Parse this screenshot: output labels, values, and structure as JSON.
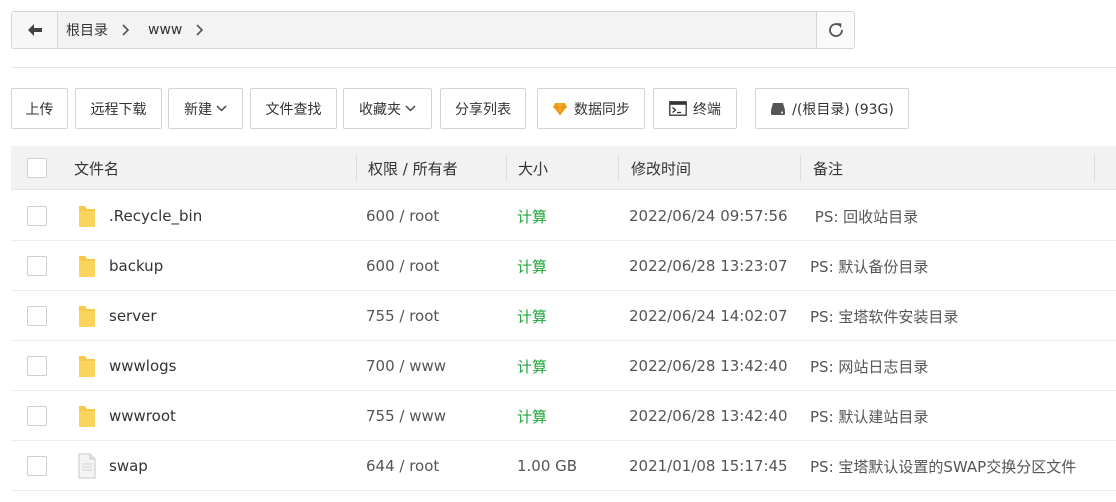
{
  "path": {
    "crumbs": [
      {
        "label": "根目录"
      },
      {
        "label": "www"
      }
    ]
  },
  "toolbar": {
    "upload": "上传",
    "remote_download": "远程下载",
    "new": "新建",
    "file_search": "文件查找",
    "favorites": "收藏夹",
    "share_list": "分享列表",
    "data_sync": "数据同步",
    "terminal": "终端",
    "disk": "/(根目录) (93G)"
  },
  "table": {
    "headers": {
      "name": "文件名",
      "perm": "权限 / 所有者",
      "size": "大小",
      "mtime": "修改时间",
      "note": "备注"
    },
    "rows": [
      {
        "name": ".Recycle_bin",
        "type": "folder",
        "perm": "600 / root",
        "size": "计算",
        "mtime": "2022/06/24 09:57:56",
        "note": " PS: 回收站目录"
      },
      {
        "name": "backup",
        "type": "folder",
        "perm": "600 / root",
        "size": "计算",
        "mtime": "2022/06/28 13:23:07",
        "note": "PS: 默认备份目录"
      },
      {
        "name": "server",
        "type": "folder",
        "perm": "755 / root",
        "size": "计算",
        "mtime": "2022/06/24 14:02:07",
        "note": "PS: 宝塔软件安装目录"
      },
      {
        "name": "wwwlogs",
        "type": "folder",
        "perm": "700 / www",
        "size": "计算",
        "mtime": "2022/06/28 13:42:40",
        "note": "PS: 网站日志目录"
      },
      {
        "name": "wwwroot",
        "type": "folder",
        "perm": "755 / www",
        "size": "计算",
        "mtime": "2022/06/28 13:42:40",
        "note": "PS: 默认建站目录"
      },
      {
        "name": "swap",
        "type": "file",
        "perm": "644 / root",
        "size": "1.00 GB",
        "mtime": "2021/01/08 15:17:45",
        "note": "PS: 宝塔默认设置的SWAP交换分区文件"
      }
    ]
  },
  "colors": {
    "calc_green": "#20a53a",
    "folder_yellow": "#f7c948",
    "gem_orange": "#f5a623"
  },
  "icons": {
    "back": "arrow-left-icon",
    "refresh": "refresh-icon",
    "folder": "folder-icon",
    "file": "file-icon",
    "sync": "gem-icon",
    "terminal": "terminal-icon",
    "disk": "disk-icon"
  }
}
